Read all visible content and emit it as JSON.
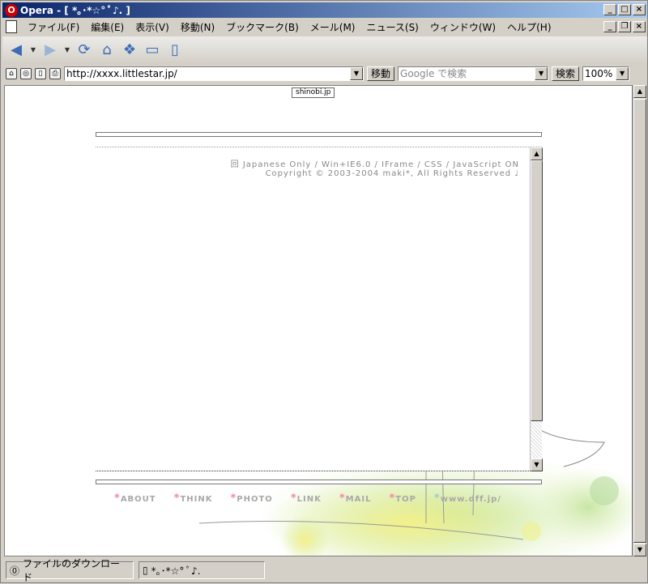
{
  "window": {
    "title": "Opera - [ *｡･*☆° ﾟ♪. ]",
    "app_icon": "O"
  },
  "menu": {
    "items": [
      "ファイル(F)",
      "編集(E)",
      "表示(V)",
      "移動(N)",
      "ブックマーク(B)",
      "メール(M)",
      "ニュース(S)",
      "ウィンドウ(W)",
      "ヘルプ(H)"
    ]
  },
  "address_bar": {
    "url": "http://xxxx.littlestar.jp/",
    "go_label": "移動",
    "search_placeholder": "Google で検索",
    "search_label": "検索",
    "zoom": "100%"
  },
  "page": {
    "badge": "shinobi.jp",
    "info_line1": "回 Japanese Only / Win+IE6.0 / IFrame / CSS / JavaScript ON",
    "info_line2": "Copyright © 2003-2004 maki*, All Rights Reserved ♩",
    "nav": [
      {
        "label": "ABOUT",
        "star": "pink"
      },
      {
        "label": "THINK",
        "star": "pink"
      },
      {
        "label": "PHOTO",
        "star": "pink"
      },
      {
        "label": "LINK",
        "star": "pink"
      },
      {
        "label": "MAIL",
        "star": "pink"
      },
      {
        "label": "TOP",
        "star": "pink"
      },
      {
        "label": "www.dff.jp/",
        "star": "blue"
      }
    ]
  },
  "status": {
    "downloads": "ファイルのダウンロード",
    "tab_title": "*｡･*☆° ﾟ♪."
  }
}
